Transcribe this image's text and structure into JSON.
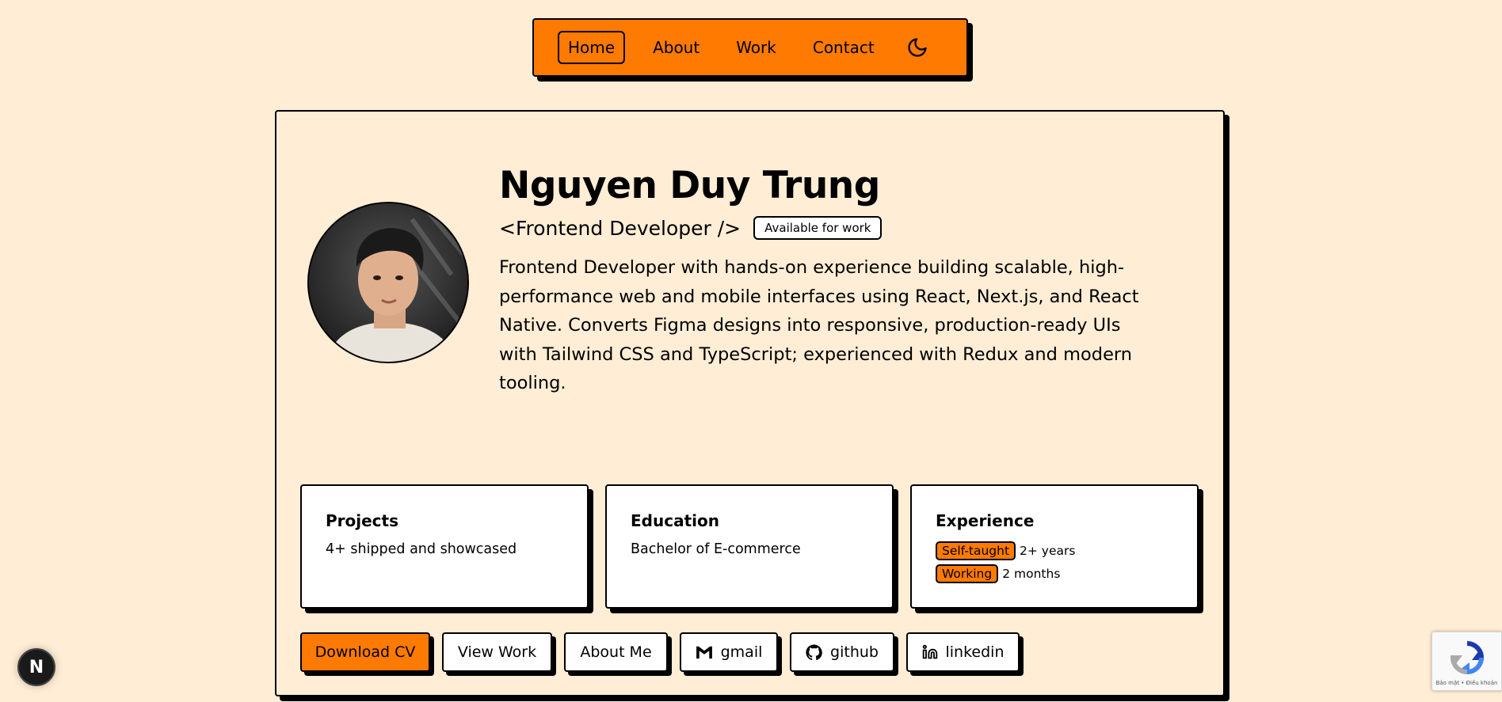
{
  "nav": {
    "items": [
      {
        "label": "Home",
        "active": true
      },
      {
        "label": "About",
        "active": false
      },
      {
        "label": "Work",
        "active": false
      },
      {
        "label": "Contact",
        "active": false
      }
    ],
    "theme_icon": "moon-icon"
  },
  "profile": {
    "name": "Nguyen Duy Trung",
    "role": "<Frontend Developer />",
    "status_badge": "Available for work",
    "bio": "Frontend Developer with hands-on experience building scalable, high-performance web and mobile interfaces using React, Next.js, and React Native. Converts Figma designs into responsive, production-ready UIs with Tailwind CSS and TypeScript; experienced with Redux and modern tooling."
  },
  "stats": {
    "projects": {
      "title": "Projects",
      "text": "4+ shipped and showcased"
    },
    "education": {
      "title": "Education",
      "text": "Bachelor of E-commerce"
    },
    "experience": {
      "title": "Experience",
      "rows": [
        {
          "tag": "Self-taught",
          "value": "2+ years"
        },
        {
          "tag": "Working",
          "value": "2 months"
        }
      ]
    }
  },
  "actions": {
    "download_cv": "Download CV",
    "view_work": "View Work",
    "about_me": "About Me",
    "gmail": "gmail",
    "github": "github",
    "linkedin": "linkedin"
  },
  "floating": {
    "next_badge": "N",
    "recaptcha_text": "Bảo mật • Điều khoản"
  },
  "colors": {
    "background": "#ffedd5",
    "accent": "#ff7a00",
    "border": "#000000",
    "surface": "#ffffff"
  }
}
